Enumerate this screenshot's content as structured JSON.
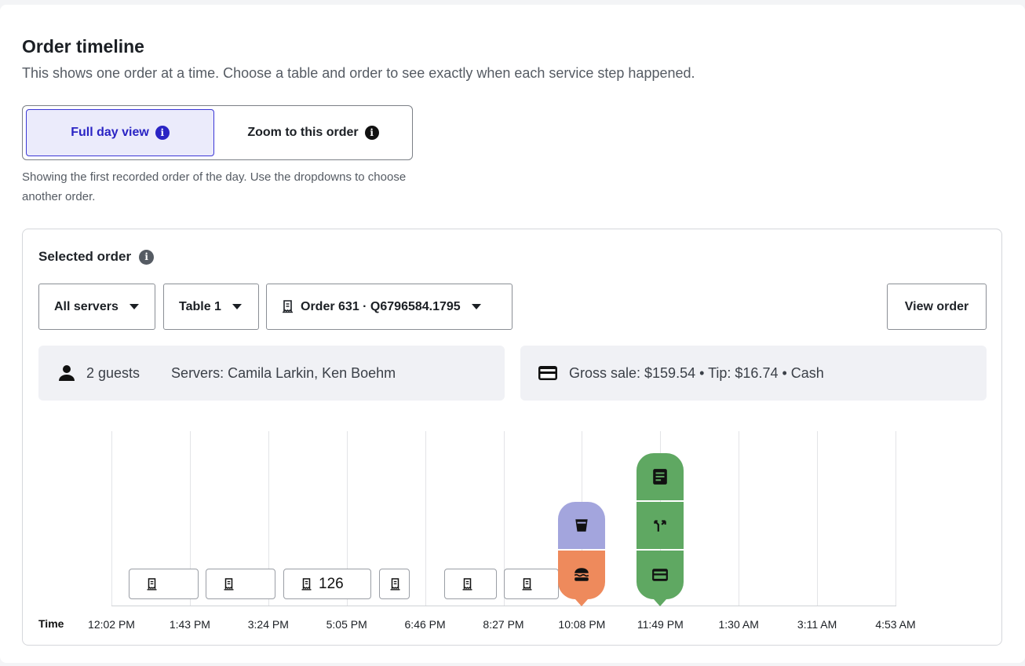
{
  "header": {
    "title": "Order timeline",
    "subtitle": "This shows one order at a time. Choose a table and order to see exactly when each service step happened."
  },
  "view_toggle": {
    "options": [
      {
        "label": "Full day view",
        "active": true
      },
      {
        "label": "Zoom to this order",
        "active": false
      }
    ],
    "helper": "Showing the first recorded order of the day. Use the dropdowns to choose another order."
  },
  "panel": {
    "title": "Selected order",
    "filters": {
      "server": "All servers",
      "table": "Table 1",
      "order": "Order 631 · Q6796584.1795"
    },
    "view_order_label": "View order",
    "summary": {
      "guests": "2 guests",
      "servers": "Servers: Camila Larkin, Ken Boehm",
      "payment": "Gross sale: $159.54 • Tip: $16.74 • Cash"
    },
    "timeline": {
      "axis_label": "Time",
      "ticks": [
        "12:02 PM",
        "1:43 PM",
        "3:24 PM",
        "5:05 PM",
        "6:46 PM",
        "8:27 PM",
        "10:08 PM",
        "11:49 PM",
        "1:30 AM",
        "3:11 AM",
        "4:53 AM"
      ],
      "order_chips": [
        {
          "label": ""
        },
        {
          "label": ""
        },
        {
          "label": "126"
        },
        {
          "label": ""
        },
        {
          "label": ""
        },
        {
          "label": ""
        }
      ],
      "events": [
        {
          "time": "10:08 PM",
          "steps": [
            "drink",
            "food"
          ],
          "colors": [
            "#a3a5dd",
            "#ee8a5c"
          ]
        },
        {
          "time": "11:49 PM",
          "steps": [
            "order",
            "split",
            "payment"
          ],
          "colors": [
            "#5fa862",
            "#5fa862",
            "#5fa862"
          ]
        }
      ]
    }
  },
  "colors": {
    "accent": "#2a24c4",
    "accent_bg": "#ebebfb",
    "drink": "#a3a5dd",
    "food": "#ee8a5c",
    "order_group": "#5fa862"
  }
}
